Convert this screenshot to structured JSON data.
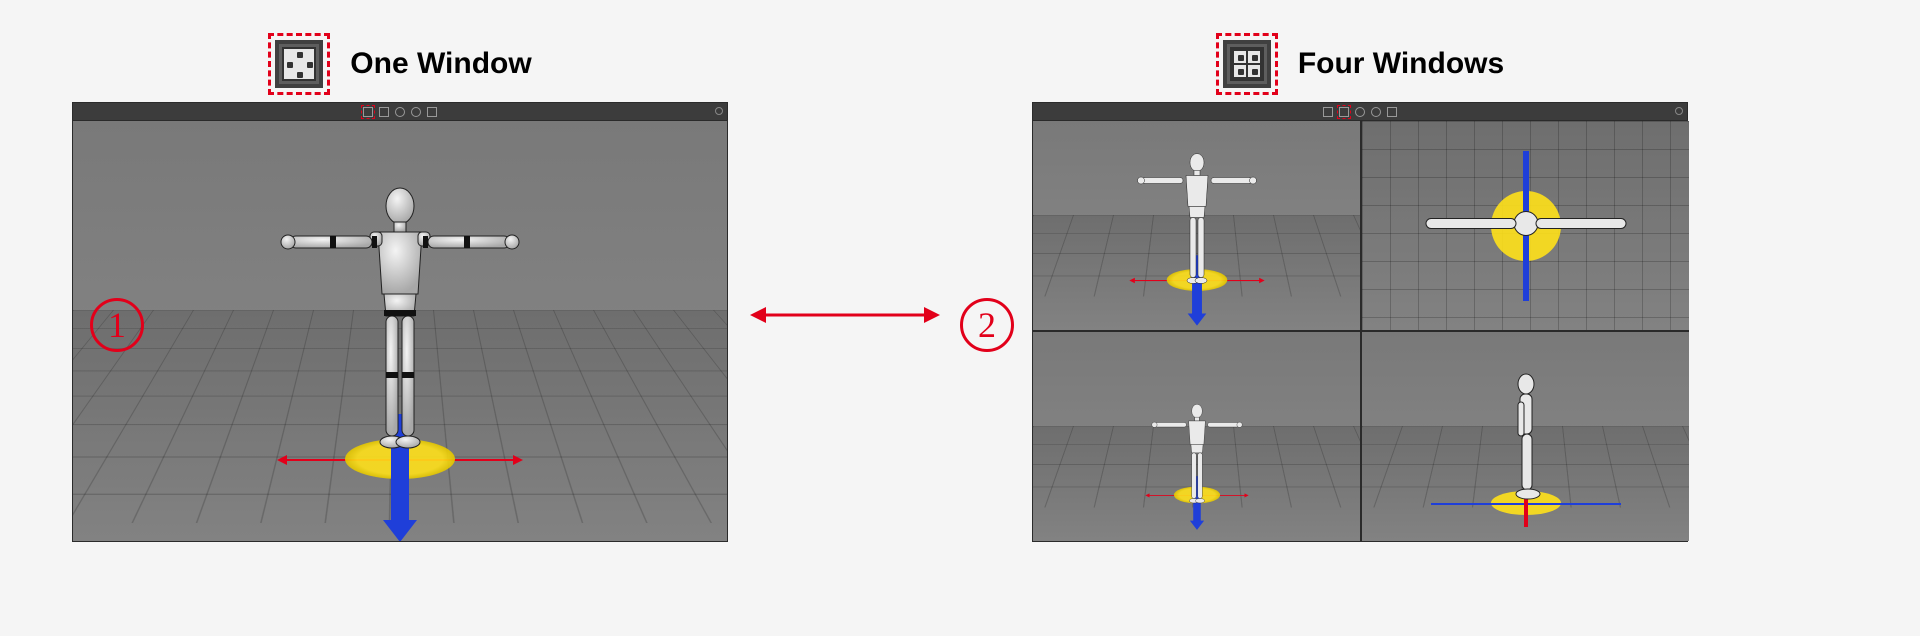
{
  "left": {
    "title": "One Window",
    "badge": "1",
    "layout_icon": "single-view-icon",
    "active_toolbar_icon": "single"
  },
  "right": {
    "title": "Four Windows",
    "badge": "2",
    "layout_icon": "four-view-icon",
    "active_toolbar_icon": "quad"
  },
  "scene": {
    "character": "humanoid-mannequin",
    "pose": "T-pose",
    "gizmo": {
      "disc_color": "#ffe11a",
      "x_axis_color": "#e2001a",
      "z_axis_color": "#1f3fd9"
    }
  },
  "colors": {
    "highlight": "#e2001a",
    "viewport_bg": "#808080",
    "toolbar_bg": "#3c3c3c"
  }
}
